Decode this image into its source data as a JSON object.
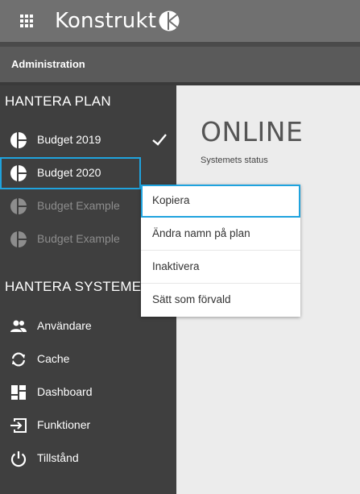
{
  "header": {
    "app_name": "Konstrukt",
    "logo_icon": "konstrukt-logo-icon",
    "menu_icon": "apps-grid-icon"
  },
  "admin": {
    "title": "Administration"
  },
  "sidebar": {
    "plan_section": {
      "title": "HANTERA PLAN",
      "items": [
        {
          "label": "Budget 2019",
          "icon": "pie-chart-icon",
          "selected": true
        },
        {
          "label": "Budget 2020",
          "icon": "pie-chart-icon",
          "focused": true
        },
        {
          "label": "Budget Example",
          "icon": "pie-chart-icon",
          "inactive": true
        },
        {
          "label": "Budget Example",
          "icon": "pie-chart-icon",
          "inactive": true
        }
      ]
    },
    "system_section": {
      "title": "HANTERA SYSTEMET",
      "items": [
        {
          "label": "Användare",
          "icon": "users-icon"
        },
        {
          "label": "Cache",
          "icon": "refresh-icon"
        },
        {
          "label": "Dashboard",
          "icon": "dashboard-icon"
        },
        {
          "label": "Funktioner",
          "icon": "functions-icon"
        },
        {
          "label": "Tillstånd",
          "icon": "power-icon"
        }
      ]
    }
  },
  "main": {
    "status": "ONLINE",
    "status_label": "Systemets status"
  },
  "context_menu": {
    "items": [
      {
        "label": "Kopiera",
        "active": true
      },
      {
        "label": "Ändra namn på plan"
      },
      {
        "label": "Inaktivera"
      },
      {
        "label": "Sätt som förvald"
      }
    ]
  },
  "colors": {
    "accent": "#1fa3de",
    "sidebar_bg": "#3f3f3f",
    "header_bg": "#707070"
  }
}
